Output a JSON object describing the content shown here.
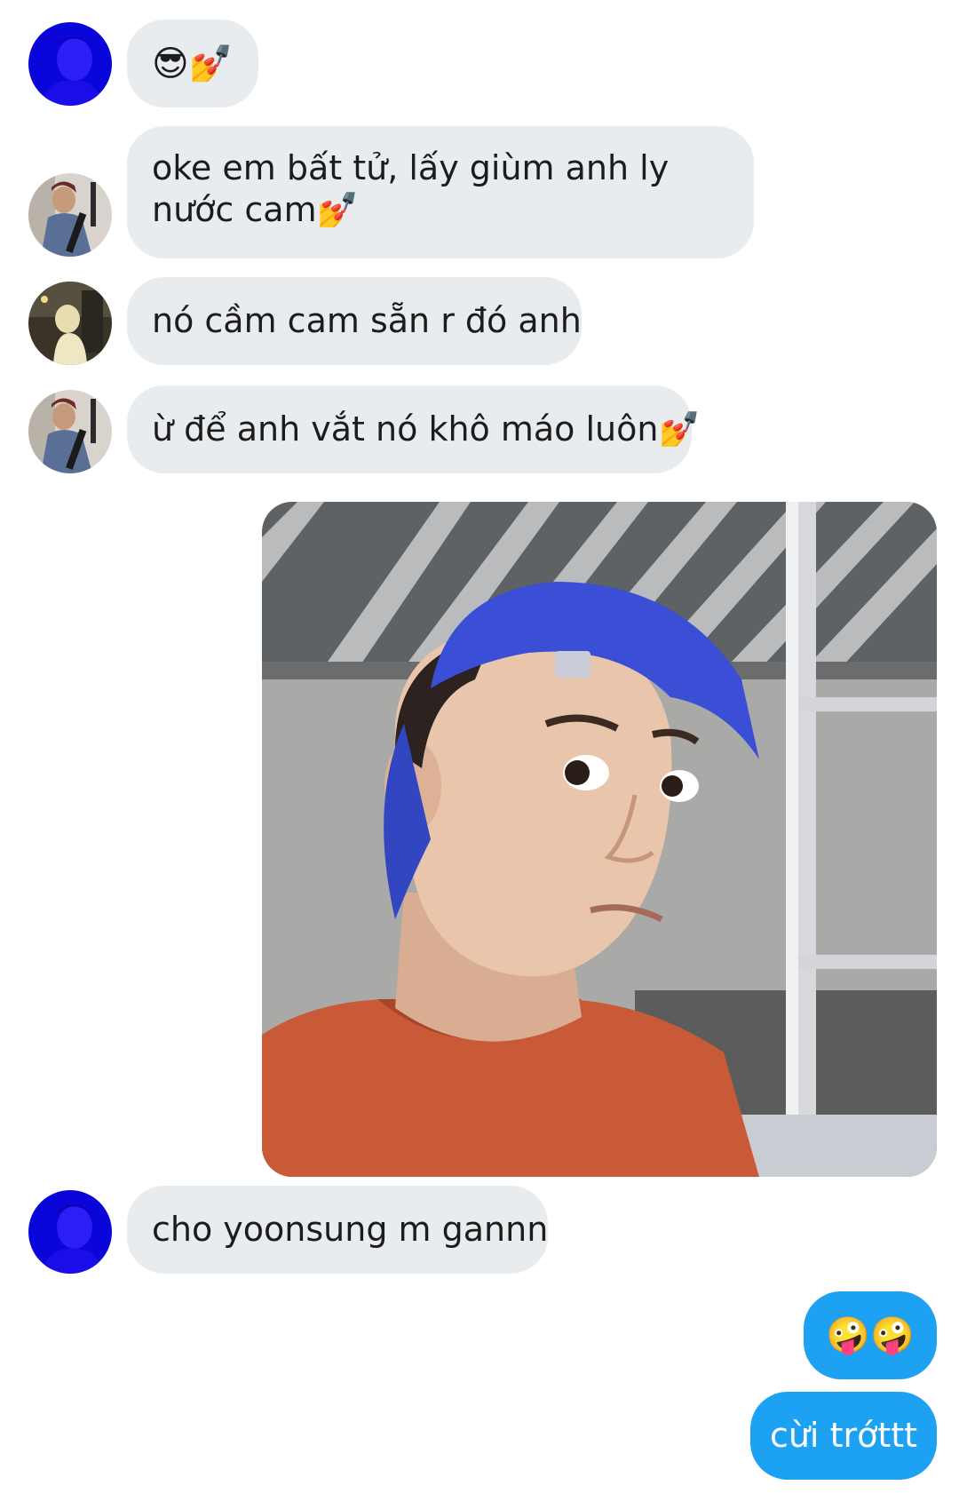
{
  "messages": [
    {
      "sender": "blue-avatar",
      "text": "😎💅"
    },
    {
      "sender": "guitar-avatar",
      "text": "oke em bất tử, lấy giùm anh ly nước cam💅"
    },
    {
      "sender": "street-avatar",
      "text": "nó cầm cam sẵn r đó anh"
    },
    {
      "sender": "guitar-avatar",
      "text": "ừ để anh vắt nó khô máo luôn💅"
    },
    {
      "sender": "outgoing",
      "type": "photo"
    },
    {
      "sender": "blue-avatar",
      "text": "cho yoonsung m gannn"
    },
    {
      "sender": "outgoing",
      "text": "🤪🤪"
    },
    {
      "sender": "outgoing",
      "text": "cừi trớttt"
    }
  ],
  "colors": {
    "incoming_bubble": "#e9ecef",
    "outgoing_bubble": "#1da1f2",
    "incoming_text": "#1c1c1c",
    "outgoing_text": "#ffffff",
    "cap_blue": "#3a4fd6",
    "shirt_orange": "#c85a38"
  },
  "icons": [
    "smiling-face-with-sunglasses-emoji",
    "nail-polish-emoji",
    "zany-face-emoji"
  ]
}
